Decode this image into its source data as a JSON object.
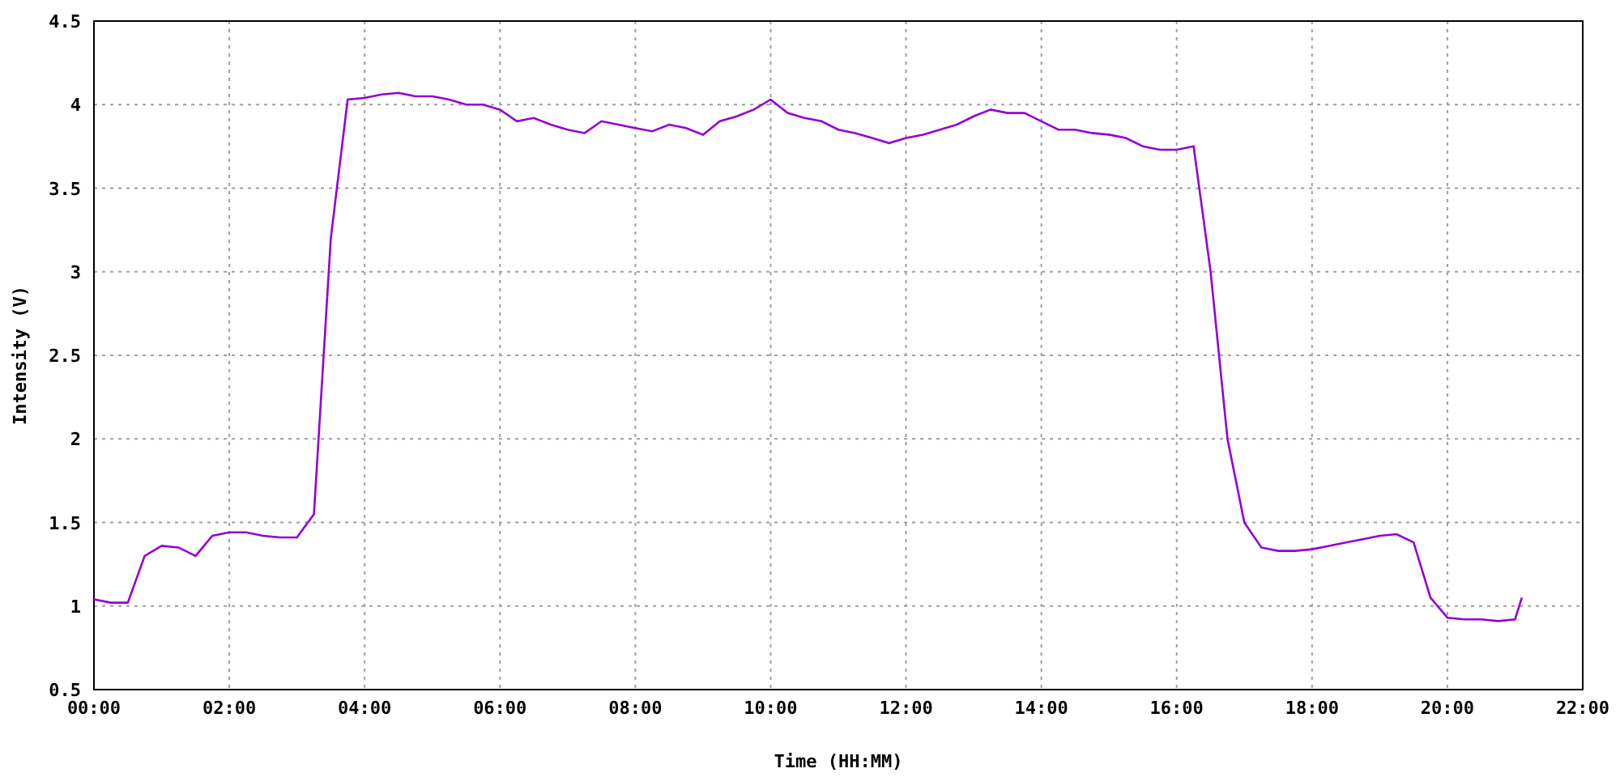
{
  "chart_data": {
    "type": "line",
    "xlabel": "Time (HH:MM)",
    "ylabel": "Intensity (V)",
    "xlim": [
      0,
      22
    ],
    "ylim": [
      0.5,
      4.5
    ],
    "xticks": [
      {
        "value": 0,
        "label": "00:00"
      },
      {
        "value": 2,
        "label": "02:00"
      },
      {
        "value": 4,
        "label": "04:00"
      },
      {
        "value": 6,
        "label": "06:00"
      },
      {
        "value": 8,
        "label": "08:00"
      },
      {
        "value": 10,
        "label": "10:00"
      },
      {
        "value": 12,
        "label": "12:00"
      },
      {
        "value": 14,
        "label": "14:00"
      },
      {
        "value": 16,
        "label": "16:00"
      },
      {
        "value": 18,
        "label": "18:00"
      },
      {
        "value": 20,
        "label": "20:00"
      },
      {
        "value": 22,
        "label": "22:00"
      }
    ],
    "yticks": [
      {
        "value": 0.5,
        "label": "0.5"
      },
      {
        "value": 1,
        "label": "1"
      },
      {
        "value": 1.5,
        "label": "1.5"
      },
      {
        "value": 2,
        "label": "2"
      },
      {
        "value": 2.5,
        "label": "2.5"
      },
      {
        "value": 3,
        "label": "3"
      },
      {
        "value": 3.5,
        "label": "3.5"
      },
      {
        "value": 4,
        "label": "4"
      },
      {
        "value": 4.5,
        "label": "4.5"
      }
    ],
    "x": [
      0,
      0.25,
      0.5,
      0.75,
      1,
      1.25,
      1.5,
      1.75,
      2,
      2.25,
      2.5,
      2.75,
      3,
      3.25,
      3.5,
      3.75,
      4,
      4.25,
      4.5,
      4.75,
      5,
      5.25,
      5.5,
      5.75,
      6,
      6.25,
      6.5,
      6.75,
      7,
      7.25,
      7.5,
      7.75,
      8,
      8.25,
      8.5,
      8.75,
      9,
      9.25,
      9.5,
      9.75,
      10,
      10.25,
      10.5,
      10.75,
      11,
      11.25,
      11.5,
      11.75,
      12,
      12.25,
      12.5,
      12.75,
      13,
      13.25,
      13.5,
      13.75,
      14,
      14.25,
      14.5,
      14.75,
      15,
      15.25,
      15.5,
      15.75,
      16,
      16.25,
      16.5,
      16.75,
      17,
      17.25,
      17.5,
      17.75,
      18,
      18.25,
      18.5,
      18.75,
      19,
      19.25,
      19.5,
      19.75,
      20,
      20.25,
      20.5,
      20.75,
      21,
      21.1
    ],
    "grid": true,
    "series": [
      {
        "color": "#9400d3",
        "values": [
          1.04,
          1.02,
          1.02,
          1.3,
          1.36,
          1.35,
          1.3,
          1.42,
          1.44,
          1.44,
          1.42,
          1.41,
          1.41,
          1.55,
          3.2,
          4.03,
          4.04,
          4.06,
          4.07,
          4.05,
          4.05,
          4.03,
          4.0,
          4.0,
          3.97,
          3.9,
          3.92,
          3.88,
          3.85,
          3.83,
          3.9,
          3.88,
          3.86,
          3.84,
          3.88,
          3.86,
          3.82,
          3.9,
          3.93,
          3.97,
          4.03,
          3.95,
          3.92,
          3.9,
          3.85,
          3.83,
          3.8,
          3.77,
          3.8,
          3.82,
          3.85,
          3.88,
          3.93,
          3.97,
          3.95,
          3.95,
          3.9,
          3.85,
          3.85,
          3.83,
          3.82,
          3.8,
          3.75,
          3.73,
          3.73,
          3.75,
          3.0,
          2.0,
          1.5,
          1.35,
          1.33,
          1.33,
          1.34,
          1.36,
          1.38,
          1.4,
          1.42,
          1.43,
          1.38,
          1.05,
          0.93,
          0.92,
          0.92,
          0.91,
          0.92,
          1.05
        ]
      }
    ]
  }
}
